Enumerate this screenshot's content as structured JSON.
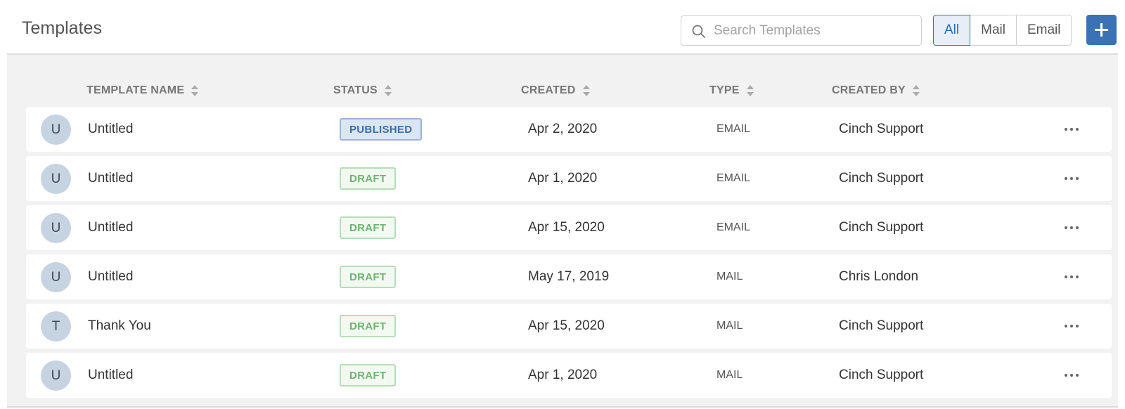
{
  "header": {
    "title": "Templates",
    "search_placeholder": "Search Templates",
    "search_value": "",
    "filters": [
      {
        "label": "All",
        "active": true
      },
      {
        "label": "Mail",
        "active": false
      },
      {
        "label": "Email",
        "active": false
      }
    ],
    "add_label": "+"
  },
  "table": {
    "columns": [
      "TEMPLATE NAME",
      "STATUS",
      "CREATED",
      "TYPE",
      "CREATED BY"
    ],
    "rows": [
      {
        "initial": "U",
        "name": "Untitled",
        "status": "PUBLISHED",
        "status_kind": "published",
        "created": "Apr 2, 2020",
        "type": "EMAIL",
        "created_by": "Cinch Support"
      },
      {
        "initial": "U",
        "name": "Untitled",
        "status": "DRAFT",
        "status_kind": "draft",
        "created": "Apr 1, 2020",
        "type": "EMAIL",
        "created_by": "Cinch Support"
      },
      {
        "initial": "U",
        "name": "Untitled",
        "status": "DRAFT",
        "status_kind": "draft",
        "created": "Apr 15, 2020",
        "type": "EMAIL",
        "created_by": "Cinch Support"
      },
      {
        "initial": "U",
        "name": "Untitled",
        "status": "DRAFT",
        "status_kind": "draft",
        "created": "May 17, 2019",
        "type": "MAIL",
        "created_by": "Chris London"
      },
      {
        "initial": "T",
        "name": "Thank You",
        "status": "DRAFT",
        "status_kind": "draft",
        "created": "Apr 15, 2020",
        "type": "MAIL",
        "created_by": "Cinch Support"
      },
      {
        "initial": "U",
        "name": "Untitled",
        "status": "DRAFT",
        "status_kind": "draft",
        "created": "Apr 1, 2020",
        "type": "MAIL",
        "created_by": "Cinch Support"
      }
    ]
  },
  "icons": {
    "search": "search-icon",
    "sort": "sort-icon",
    "more": "more-icon",
    "add": "plus-icon"
  },
  "colors": {
    "accent": "#3a72b5",
    "published_text": "#3a6ea9",
    "draft_text": "#6fb36f",
    "avatar_bg": "#c6d3e1",
    "content_bg": "#f2f2f2"
  }
}
